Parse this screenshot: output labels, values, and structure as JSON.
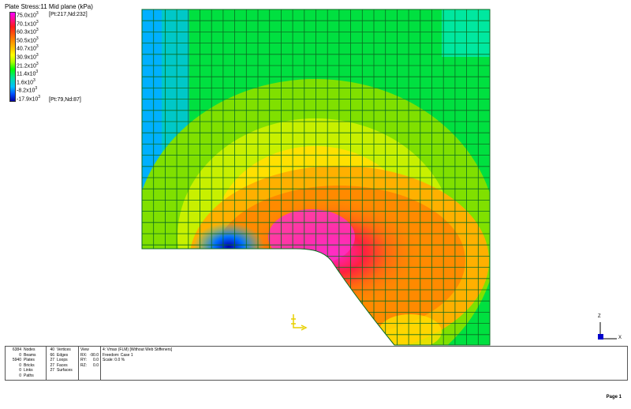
{
  "legend": {
    "title": "Plate Stress:11 Mid plane (kPa)",
    "levels": [
      {
        "mant": "75.0",
        "exp": "3"
      },
      {
        "mant": "70.1",
        "exp": "3"
      },
      {
        "mant": "60.3",
        "exp": "3"
      },
      {
        "mant": "50.5",
        "exp": "3"
      },
      {
        "mant": "40.7",
        "exp": "3"
      },
      {
        "mant": "30.9",
        "exp": "3"
      },
      {
        "mant": "21.2",
        "exp": "3"
      },
      {
        "mant": "11.4",
        "exp": "3"
      },
      {
        "mant": "1.6",
        "exp": "3"
      },
      {
        "mant": "-8.2",
        "exp": "3"
      },
      {
        "mant": "-17.9",
        "exp": "3"
      }
    ],
    "max_point": "[Pt:217,Nd:232]",
    "min_point": "[Pt:79,Nd:87]"
  },
  "axis": {
    "z_label": "Z",
    "x_label": "X"
  },
  "stats": {
    "col1": [
      {
        "value": "6384",
        "label": "Nodes"
      },
      {
        "value": "0",
        "label": "Beams"
      },
      {
        "value": "5940",
        "label": "Plates"
      },
      {
        "value": "0",
        "label": "Bricks"
      },
      {
        "value": "0",
        "label": "Links"
      },
      {
        "value": "0",
        "label": "Paths"
      }
    ],
    "col2": [
      {
        "value": "40",
        "label": "Vertices"
      },
      {
        "value": "66",
        "label": "Edges"
      },
      {
        "value": "27",
        "label": "Loops"
      },
      {
        "value": "27",
        "label": "Faces"
      },
      {
        "value": "27",
        "label": "Surfaces"
      }
    ],
    "view": {
      "heading": "View",
      "rows": [
        {
          "label": "RX:",
          "value": "-90.0"
        },
        {
          "label": "RY:",
          "value": "0.0"
        },
        {
          "label": "RZ:",
          "value": "0.0"
        }
      ]
    },
    "info": {
      "line1": "4: Vmax (FLM) [Without Web Stiffeners]",
      "line2": "Freedom: Case 1",
      "line3": "Scale: 0.0 %"
    }
  },
  "page_label": "Page 1"
}
